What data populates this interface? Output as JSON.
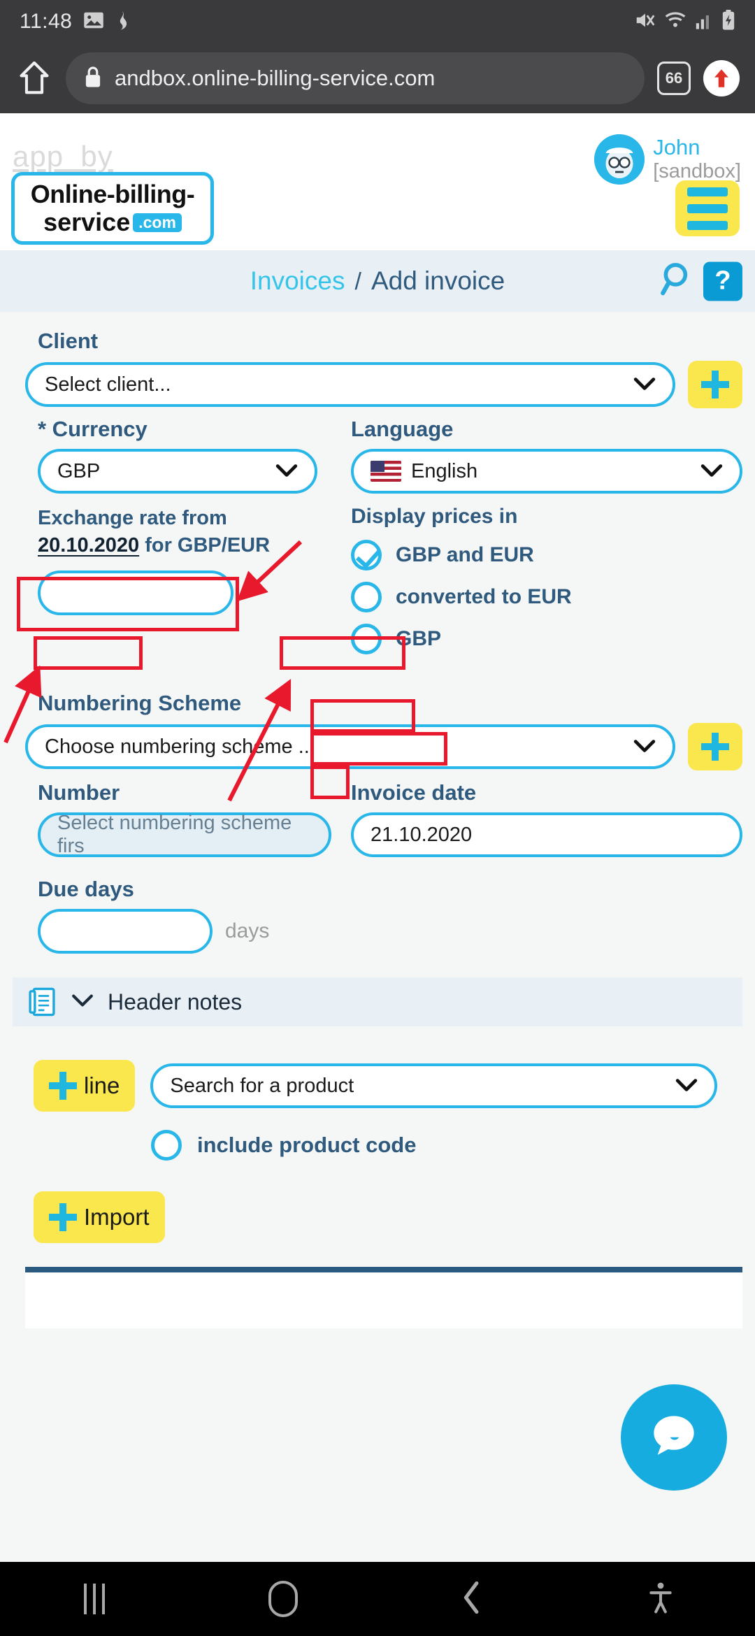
{
  "status_bar": {
    "time": "11:48",
    "left_icons": [
      "image-icon",
      "scan-icon"
    ],
    "right_icons": [
      "mute-icon",
      "wifi-icon",
      "signal-icon",
      "battery-charging-icon"
    ]
  },
  "browser": {
    "home_icon": "home-icon",
    "lock_icon": "lock-icon",
    "url": "andbox.online-billing-service.com",
    "tab_count": "66",
    "menu_icon": "up-arrow-icon"
  },
  "header": {
    "app_by": "app_by",
    "logo_line1": "Online-billing-",
    "logo_line2": "service",
    "logo_tld": ".com",
    "user_name": "John",
    "user_sub": "[sandbox]",
    "avatar_icon": "avatar-icon",
    "menu_icon": "hamburger-icon"
  },
  "breadcrumb": {
    "parent": "Invoices",
    "separator": "/",
    "current": "Add invoice",
    "search_icon": "search-icon",
    "help_label": "?"
  },
  "form": {
    "client_label": "Client",
    "client_value": "Select client...",
    "add_client_icon": "plus-icon",
    "currency_label": "* Currency",
    "currency_value": "GBP",
    "language_label": "Language",
    "language_value": "English",
    "language_flag": "us-flag-icon",
    "exchange_prefix": "Exchange rate",
    "exchange_from": " from",
    "exchange_date": "20.10.2020",
    "exchange_pair": " for GBP/EUR",
    "exchange_rate_value": "",
    "display_prices_label": "Display prices in",
    "display_options": [
      {
        "label": "GBP and EUR",
        "checked": true
      },
      {
        "label": "converted to EUR",
        "checked": false
      },
      {
        "label": "GBP",
        "checked": false
      }
    ],
    "numbering_label": "Numbering Scheme",
    "numbering_value": "Choose numbering scheme ...",
    "add_numbering_icon": "plus-icon",
    "number_label": "Number",
    "number_placeholder": "Select numbering scheme firs",
    "invoice_date_label": "Invoice date",
    "invoice_date_value": "21.10.2020",
    "due_days_label": "Due days",
    "due_days_value": "",
    "due_days_unit": "days",
    "header_notes_label": "Header notes",
    "header_notes_icon": "notes-icon",
    "header_notes_chevron": "chevron-down-icon",
    "add_line_label": "line",
    "product_search_value": "Search for a product",
    "include_product_code_label": "include product code",
    "include_product_code_checked": false,
    "import_label": "Import"
  },
  "chat": {
    "icon": "chat-bubble-icon"
  },
  "nav_bar": {
    "recents_icon": "recents-icon",
    "home_icon": "home-circle-icon",
    "back_icon": "back-chevron-icon",
    "accessibility_icon": "accessibility-icon"
  },
  "annotations": {
    "color": "#e8192c",
    "boxes": [
      "currency-select",
      "exchange-rate-label",
      "display-prices-in-label",
      "gbp-and-eur-label",
      "converted-to-eur-label",
      "gbp-label"
    ],
    "arrows": [
      "arrow-to-currency-select",
      "arrow-to-exchange-rate",
      "arrow-to-display-prices"
    ]
  }
}
